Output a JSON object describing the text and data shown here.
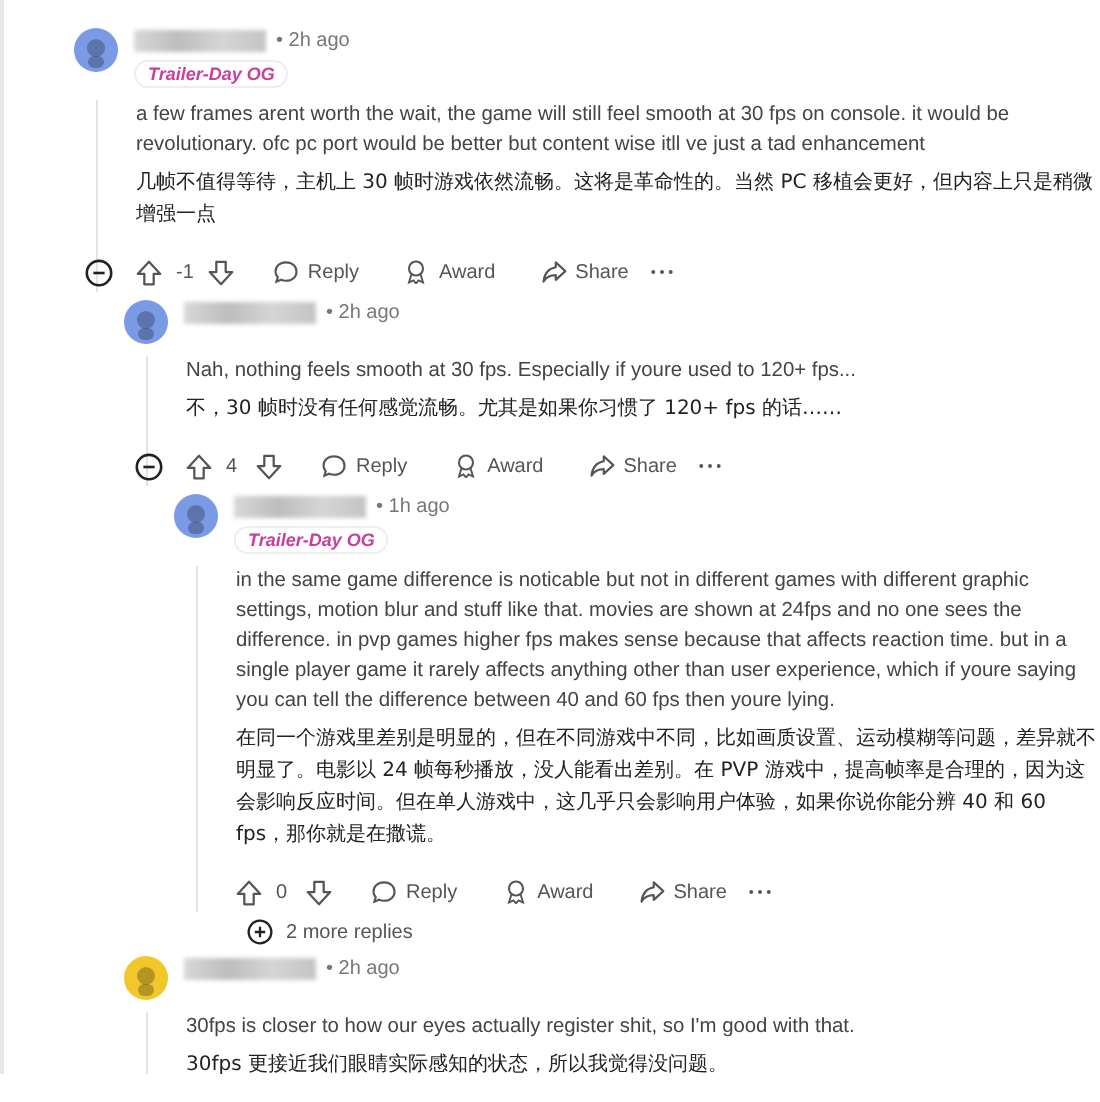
{
  "comments": [
    {
      "color": "#7b9ae6",
      "time": "• 2h ago",
      "flair": "Trailer-Day OG",
      "text": "a few frames arent worth the wait, the game will still feel smooth at 30 fps on console. it would be revolutionary. ofc pc port would be better but content wise itll ve just a tad enhancement",
      "translation": "几帧不值得等待，主机上 30 帧时游戏依然流畅。这将是革命性的。当然 PC 移植会更好，但内容上只是稍微增强一点",
      "collapse": true,
      "actions": {
        "votes": "-1",
        "reply": "Reply",
        "award": "Award",
        "share": "Share"
      },
      "children": [
        {
          "color": "#7b9ae6",
          "time": "• 2h ago",
          "text": "Nah, nothing feels smooth at 30 fps. Especially if youre used to 120+ fps...",
          "translation": "不，30 帧时没有任何感觉流畅。尤其是如果你习惯了 120+ fps 的话……",
          "collapse": true,
          "actions": {
            "votes": "4",
            "reply": "Reply",
            "award": "Award",
            "share": "Share"
          },
          "children": [
            {
              "color": "#7b9ae6",
              "time": "• 1h ago",
              "flair": "Trailer-Day OG",
              "text": "in the same game difference is noticable but not in different games with different graphic settings, motion blur and stuff like that. movies are shown at 24fps and no one sees the difference. in pvp games higher fps makes sense because that affects reaction time. but in a single player game it rarely affects anything other than user experience, which if youre saying you can tell the difference between 40 and 60 fps then youre lying.",
              "translation": "在同一个游戏里差别是明显的，但在不同游戏中不同，比如画质设置、运动模糊等问题，差异就不明显了。电影以 24 帧每秒播放，没人能看出差别。在 PVP 游戏中，提高帧率是合理的，因为这会影响反应时间。但在单人游戏中，这几乎只会影响用户体验，如果你说你能分辨 40 和 60 fps，那你就是在撒谎。",
              "actions": {
                "votes": "0",
                "reply": "Reply",
                "award": "Award",
                "share": "Share"
              },
              "more_replies": "2 more replies"
            }
          ]
        },
        {
          "color": "#f2c72c",
          "time": "• 2h ago",
          "text": "30fps is closer to how our eyes actually register shit, so I'm good with that.",
          "translation": "30fps 更接近我们眼睛实际感知的状态，所以我觉得没问题。"
        }
      ]
    }
  ]
}
